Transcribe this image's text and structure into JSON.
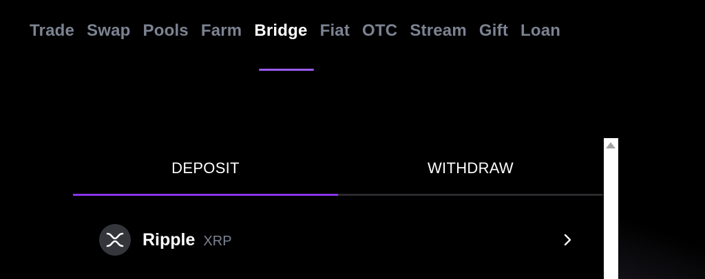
{
  "nav": {
    "tabs": [
      {
        "label": "Trade"
      },
      {
        "label": "Swap"
      },
      {
        "label": "Pools"
      },
      {
        "label": "Farm"
      },
      {
        "label": "Bridge",
        "active": true
      },
      {
        "label": "Fiat"
      },
      {
        "label": "OTC"
      },
      {
        "label": "Stream"
      },
      {
        "label": "Gift"
      },
      {
        "label": "Loan"
      }
    ]
  },
  "bridge": {
    "tabs": {
      "deposit": "DEPOSIT",
      "withdraw": "WITHDRAW"
    },
    "active_tab": "deposit",
    "assets": [
      {
        "name": "Ripple",
        "ticker": "XRP",
        "icon": "xrp-logo-icon",
        "action_icon": "chevron-right-icon"
      }
    ]
  },
  "colors": {
    "background": "#000000",
    "accent": "#8a35f0",
    "muted_text": "#7c8392",
    "active_text": "#ffffff"
  }
}
